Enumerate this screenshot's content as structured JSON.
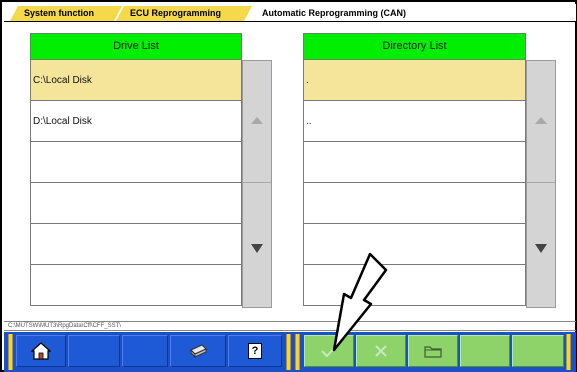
{
  "breadcrumb": {
    "items": [
      "System function",
      "ECU Reprogramming",
      "Automatic Reprogramming (CAN)"
    ]
  },
  "drive_list": {
    "header": "Drive List",
    "rows": [
      "C:\\Local Disk",
      "D:\\Local Disk",
      "",
      "",
      "",
      ""
    ],
    "selected_index": 0
  },
  "directory_list": {
    "header": "Directory List",
    "rows": [
      ".",
      "..",
      "",
      "",
      "",
      ""
    ],
    "selected_index": 0
  },
  "path": "C:\\MUTSW\\MUT3\\RpgData\\Cff\\CFF_SST\\",
  "toolbar": {
    "home_icon": "home-icon",
    "printer_icon": "printer-icon",
    "help_label": "?",
    "ok_icon": "check-icon",
    "cancel_icon": "cross-icon",
    "folder_icon": "folder-icon"
  },
  "colors": {
    "header_green": "#00ee00",
    "selected_row": "#f4e59b",
    "toolbar_blue": "#1b50c8",
    "action_green": "#8ed36a",
    "crumb_yellow": "#f5d94a"
  }
}
